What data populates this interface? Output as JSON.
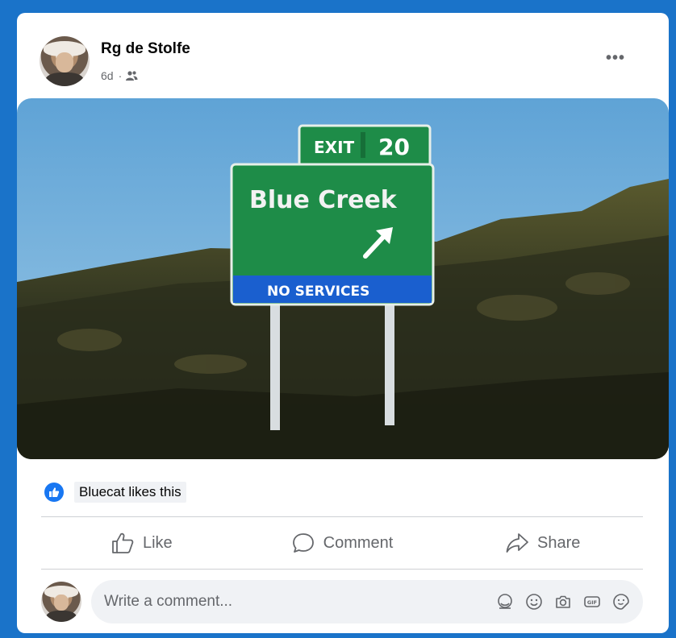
{
  "post": {
    "author": "Rg de Stolfe",
    "time": "6d",
    "separator": "·",
    "audience_icon": "friends-icon",
    "more_label": "•••"
  },
  "photo": {
    "sign_exit_label": "EXIT",
    "sign_exit_number": "20",
    "sign_destination": "Blue Creek",
    "sign_services": "NO SERVICES"
  },
  "reactions": {
    "summary": "Bluecat likes this",
    "icon": "thumbs-up-icon"
  },
  "actions": {
    "like_label": "Like",
    "comment_label": "Comment",
    "share_label": "Share"
  },
  "comment_bar": {
    "placeholder": "Write a comment...",
    "icons": [
      "avatar-sticker-icon",
      "emoji-icon",
      "camera-icon",
      "gif-icon",
      "sticker-icon"
    ]
  },
  "colors": {
    "frame": "#1a73c9",
    "accent": "#1877f2",
    "sign_green": "#1e8c48",
    "sign_blue": "#1a5fcf"
  }
}
